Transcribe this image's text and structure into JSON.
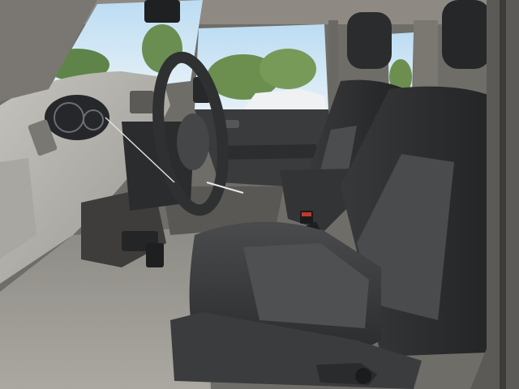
{
  "scene": {
    "colors": {
      "sky": "#c9e3f5",
      "foliage": "#6c8f4f",
      "dashboard": "#b9b7b1",
      "dash_shadow": "#8e8c86",
      "seat_dark": "#2d2e30",
      "seat_insert": "#4b4c4e",
      "floor": "#9e9c95",
      "door_panel": "#3a3b3d",
      "steering": "#3b3c3e",
      "pillar": "#5c5a57"
    }
  }
}
